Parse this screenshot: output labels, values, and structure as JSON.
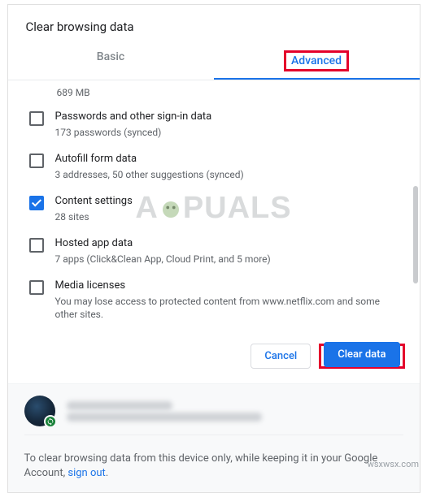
{
  "dialog": {
    "title": "Clear browsing data",
    "tabs": {
      "basic": "Basic",
      "advanced": "Advanced",
      "active": "advanced"
    },
    "truncated_top": "689 MB",
    "items": [
      {
        "title": "Passwords and other sign-in data",
        "sub": "173 passwords (synced)",
        "checked": false
      },
      {
        "title": "Autofill form data",
        "sub": "3 addresses, 50 other suggestions (synced)",
        "checked": false
      },
      {
        "title": "Content settings",
        "sub": "28 sites",
        "checked": true
      },
      {
        "title": "Hosted app data",
        "sub": "7 apps (Click&Clean App, Cloud Print, and 5 more)",
        "checked": false
      },
      {
        "title": "Media licenses",
        "sub": "You may lose access to protected content from www.netflix.com and some other sites.",
        "checked": false
      }
    ],
    "actions": {
      "cancel": "Cancel",
      "confirm": "Clear data"
    }
  },
  "footer": {
    "note_prefix": "To clear browsing data from this device only, while keeping it in your Google Account, ",
    "link": "sign out",
    "note_suffix": "."
  },
  "watermark": {
    "left": "A",
    "right": "PUALS"
  },
  "attribution": "wsxwsx.com"
}
